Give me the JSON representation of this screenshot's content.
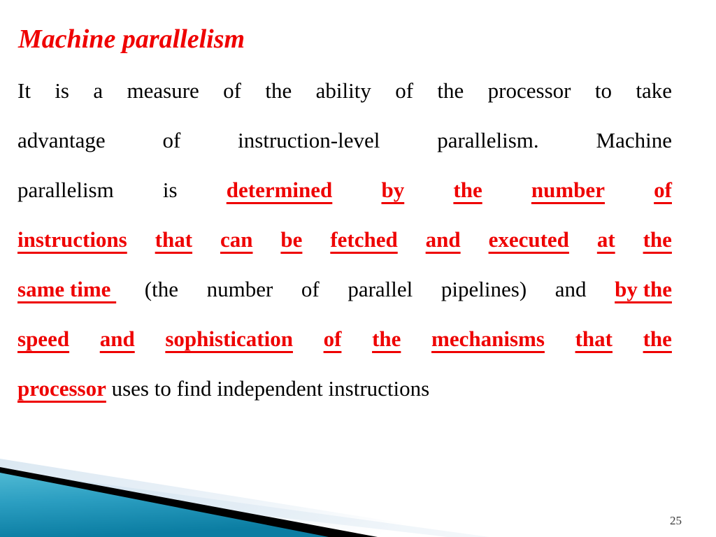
{
  "slide": {
    "number": "25",
    "title": "Machine parallelism",
    "title_color": "#ee0000",
    "background_color": "#ffffff",
    "body_text": "It is a measure of the ability of the processor to take advantage of instruction-level parallelism. Machine parallelism is determined by the number of instructions that can be fetched and executed at the same time (the number of parallel pipelines) and by the speed and sophistication of the mechanisms that the processor uses to find independent instructions",
    "highlight_color": "#ee0000",
    "body_color": "#000000",
    "lines": [
      {
        "id": "line-1",
        "align": "justify",
        "words": [
          {
            "t": "It",
            "s": "black"
          },
          {
            "t": "is",
            "s": "black"
          },
          {
            "t": "a",
            "s": "black"
          },
          {
            "t": "measure",
            "s": "black"
          },
          {
            "t": "of",
            "s": "black"
          },
          {
            "t": "the",
            "s": "black"
          },
          {
            "t": "ability",
            "s": "black"
          },
          {
            "t": "of",
            "s": "black"
          },
          {
            "t": "the",
            "s": "black"
          },
          {
            "t": "processor",
            "s": "black"
          },
          {
            "t": "to",
            "s": "black"
          },
          {
            "t": "take",
            "s": "black"
          }
        ]
      },
      {
        "id": "line-2",
        "align": "justify",
        "words": [
          {
            "t": "advantage",
            "s": "black"
          },
          {
            "t": "of",
            "s": "black"
          },
          {
            "t": "instruction-level",
            "s": "black"
          },
          {
            "t": "parallelism.",
            "s": "black"
          },
          {
            "t": "Machine",
            "s": "black"
          }
        ]
      },
      {
        "id": "line-3",
        "align": "justify",
        "words": [
          {
            "t": "parallelism",
            "s": "black"
          },
          {
            "t": "is",
            "s": "black"
          },
          {
            "t": "determined",
            "s": "red"
          },
          {
            "t": "by",
            "s": "red"
          },
          {
            "t": "the",
            "s": "red"
          },
          {
            "t": "number",
            "s": "red"
          },
          {
            "t": "of",
            "s": "red"
          }
        ]
      },
      {
        "id": "line-4",
        "align": "justify",
        "words": [
          {
            "t": "instructions",
            "s": "red"
          },
          {
            "t": "that",
            "s": "red"
          },
          {
            "t": "can",
            "s": "red"
          },
          {
            "t": "be",
            "s": "red"
          },
          {
            "t": "fetched",
            "s": "red"
          },
          {
            "t": "and",
            "s": "red"
          },
          {
            "t": "executed",
            "s": "red"
          },
          {
            "t": "at",
            "s": "red"
          },
          {
            "t": "the",
            "s": "red"
          }
        ]
      },
      {
        "id": "line-5",
        "align": "justify",
        "words": [
          {
            "t": "same time ",
            "s": "red"
          },
          {
            "t": "(the",
            "s": "black"
          },
          {
            "t": "number",
            "s": "black"
          },
          {
            "t": "of",
            "s": "black"
          },
          {
            "t": "parallel",
            "s": "black"
          },
          {
            "t": "pipelines)",
            "s": "black"
          },
          {
            "t": "and",
            "s": "black"
          },
          {
            "t": "by the",
            "s": "red"
          }
        ]
      },
      {
        "id": "line-6",
        "align": "justify",
        "words": [
          {
            "t": "speed",
            "s": "red"
          },
          {
            "t": "and",
            "s": "red"
          },
          {
            "t": "sophistication",
            "s": "red"
          },
          {
            "t": "of",
            "s": "red"
          },
          {
            "t": "the",
            "s": "red"
          },
          {
            "t": "mechanisms",
            "s": "red"
          },
          {
            "t": "that",
            "s": "red"
          },
          {
            "t": "the",
            "s": "red"
          }
        ]
      },
      {
        "id": "line-7",
        "align": "flow",
        "words": [
          {
            "t": "processor",
            "s": "red"
          },
          {
            "t": " uses to find independent instructions",
            "s": "black"
          }
        ]
      }
    ],
    "decoration": {
      "name": "bottom-left-diagonal-banner",
      "teal_light": "#3fb0cf",
      "teal_dark": "#0d7ea3",
      "stripe_color": "#000000",
      "band_light": "#ffffff",
      "band_blue": "#c9dced"
    }
  }
}
